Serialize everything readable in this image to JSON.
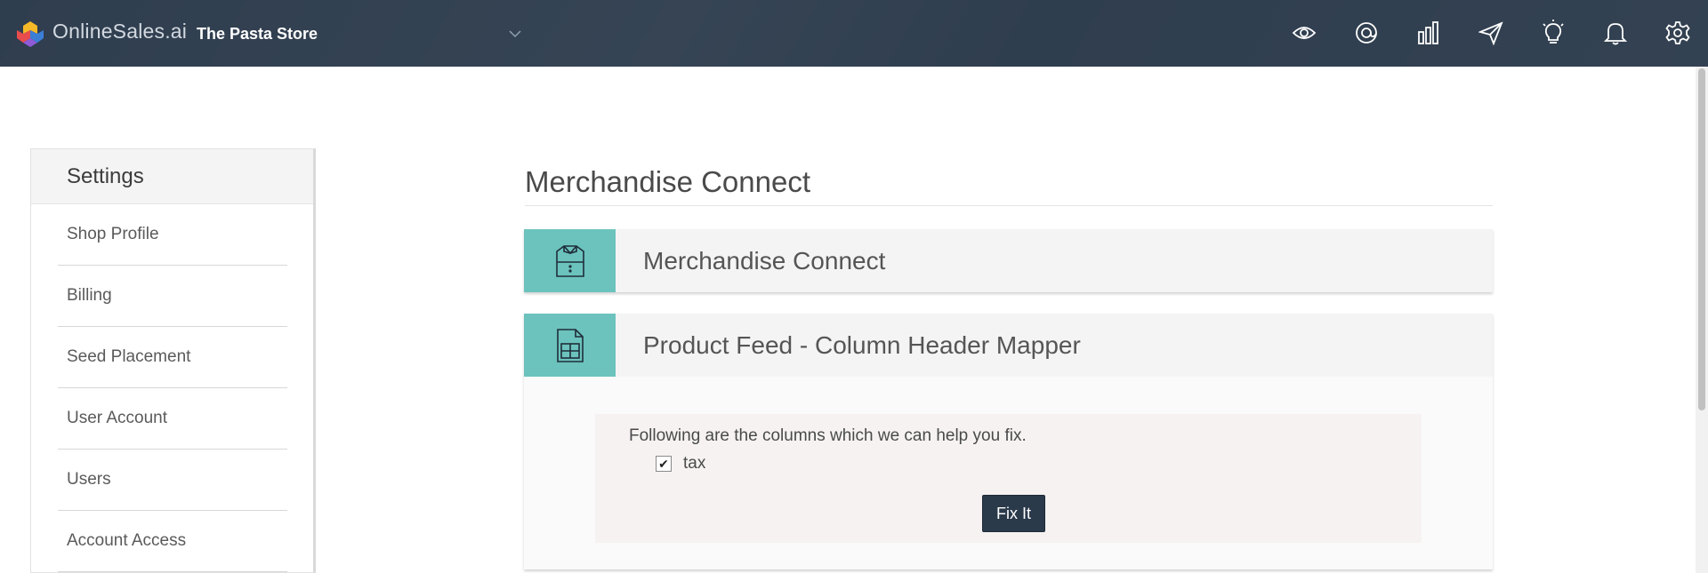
{
  "header": {
    "brand": "OnlineSales.ai",
    "store": "The Pasta Store",
    "icons": [
      "eye-icon",
      "at-target-icon",
      "bar-chart-icon",
      "send-icon",
      "lightbulb-icon",
      "bell-icon",
      "gear-icon"
    ]
  },
  "sidebar": {
    "title": "Settings",
    "items": [
      {
        "label": "Shop Profile"
      },
      {
        "label": "Billing"
      },
      {
        "label": "Seed Placement"
      },
      {
        "label": "User Account"
      },
      {
        "label": "Users"
      },
      {
        "label": "Account Access"
      }
    ]
  },
  "main": {
    "title": "Merchandise Connect",
    "panels": [
      {
        "title": "Merchandise Connect",
        "icon": "shirt-icon"
      },
      {
        "title": "Product Feed - Column Header Mapper",
        "icon": "document-icon"
      }
    ],
    "mapper": {
      "message": "Following are the columns which we can help you fix.",
      "columns": [
        {
          "label": "tax",
          "checked": true
        }
      ],
      "button": "Fix It"
    }
  },
  "colors": {
    "navbar": "#2b3a4b",
    "accent_teal": "#6cc3bd",
    "button": "#2b3a4b"
  }
}
